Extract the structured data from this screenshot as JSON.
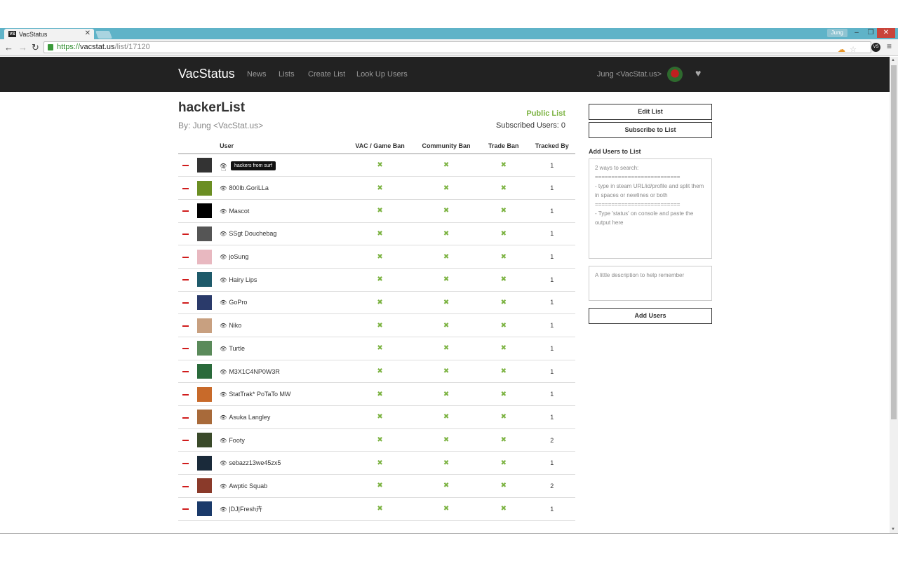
{
  "browser": {
    "tab_title": "VacStatus",
    "favicon_text": "VS",
    "profile_name": "Jung",
    "url_scheme": "https://",
    "url_host": "vacstat.us",
    "url_path": "/list/17120"
  },
  "nav": {
    "brand": "VacStatus",
    "links": [
      "News",
      "Lists",
      "Create List",
      "Look Up Users"
    ],
    "user_label": "Jung <VacStat.us>"
  },
  "list": {
    "title": "hackerList",
    "owner": "By: Jung <VacStat.us>",
    "visibility": "Public List",
    "subscribed": "Subscribed Users: 0",
    "columns": [
      "User",
      "VAC / Game Ban",
      "Community Ban",
      "Trade Ban",
      "Tracked By"
    ],
    "tooltip": "hackers from surf",
    "rows": [
      {
        "name": "",
        "tracked": "1",
        "color": "#333333"
      },
      {
        "name": "800lb.GoriLLa",
        "tracked": "1",
        "color": "#6b8e23"
      },
      {
        "name": "Mascot",
        "tracked": "1",
        "color": "#000000"
      },
      {
        "name": "SSgt Douchebag",
        "tracked": "1",
        "color": "#555555"
      },
      {
        "name": "joSung",
        "tracked": "1",
        "color": "#e8b8c0"
      },
      {
        "name": "Hairy Lips",
        "tracked": "1",
        "color": "#1e5a6a"
      },
      {
        "name": "GoPro",
        "tracked": "1",
        "color": "#2a3a6a"
      },
      {
        "name": "Niko",
        "tracked": "1",
        "color": "#c8a080"
      },
      {
        "name": "Turtle",
        "tracked": "1",
        "color": "#5a8a5a"
      },
      {
        "name": "M3X1C4NP0W3R",
        "tracked": "1",
        "color": "#2a6a3a"
      },
      {
        "name": "StatTrak* PoTaTo MW",
        "tracked": "1",
        "color": "#c86a2a"
      },
      {
        "name": "Asuka Langley",
        "tracked": "1",
        "color": "#a86a3a"
      },
      {
        "name": "Footy",
        "tracked": "2",
        "color": "#3a4a2a"
      },
      {
        "name": "sebazz13we45zx5",
        "tracked": "1",
        "color": "#1a2a3a"
      },
      {
        "name": "Awptic Squab",
        "tracked": "2",
        "color": "#8a3a2a"
      },
      {
        "name": "|DJ|Fresh卉",
        "tracked": "1",
        "color": "#1a3a6a"
      }
    ]
  },
  "sidebar": {
    "edit_label": "Edit List",
    "subscribe_label": "Subscribe to List",
    "add_heading": "Add Users to List",
    "search_placeholder": "2 ways to search:\n==========================\n- type in steam URL/id/profile and split them in spaces or newlines or both\n==========================\n- Type 'status' on console and paste the output here",
    "description_placeholder": "A little description to help remember",
    "add_button": "Add Users"
  },
  "colors": {
    "accent_green": "#7cb342",
    "remove_red": "#d01c1c",
    "nav_bg": "#222222",
    "tab_bar": "#5fb3c8"
  }
}
